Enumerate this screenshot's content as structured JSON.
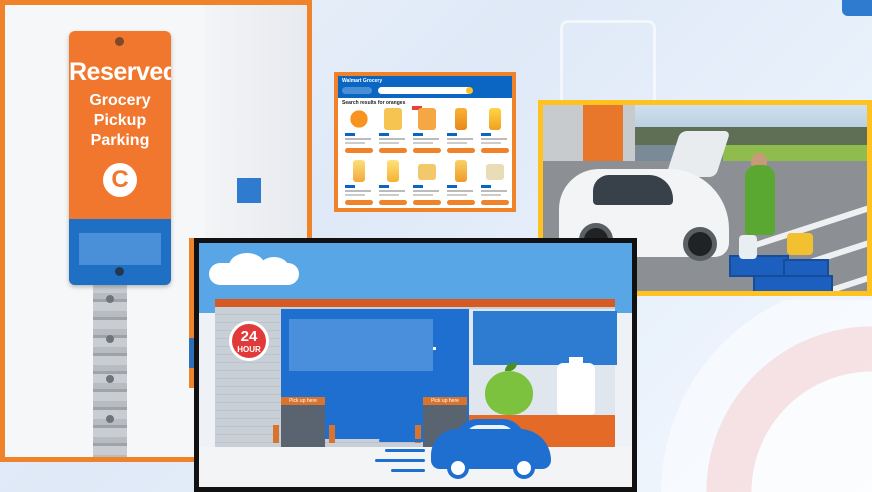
{
  "sign": {
    "title": "Reserved",
    "subtitle_line1": "Grocery Pickup",
    "subtitle_line2": "Parking",
    "letter": "C",
    "color_orange": "#f0772d",
    "color_blue": "#1f6fc4"
  },
  "website": {
    "logo": "Walmart Grocery",
    "heading": "Search results for oranges",
    "header_color": "#0a66c2",
    "accent_color": "#f0822a"
  },
  "illustration": {
    "badge_number": "24",
    "badge_unit": "HOUR",
    "door_sign_1": "Pick up here",
    "door_sign_2": "Pick up here"
  },
  "frames": {
    "sign_border_color": "#f0822a",
    "website_border_color": "#f0822a",
    "photo_border_color": "#ffc220",
    "illustration_border_color": "#111111"
  }
}
